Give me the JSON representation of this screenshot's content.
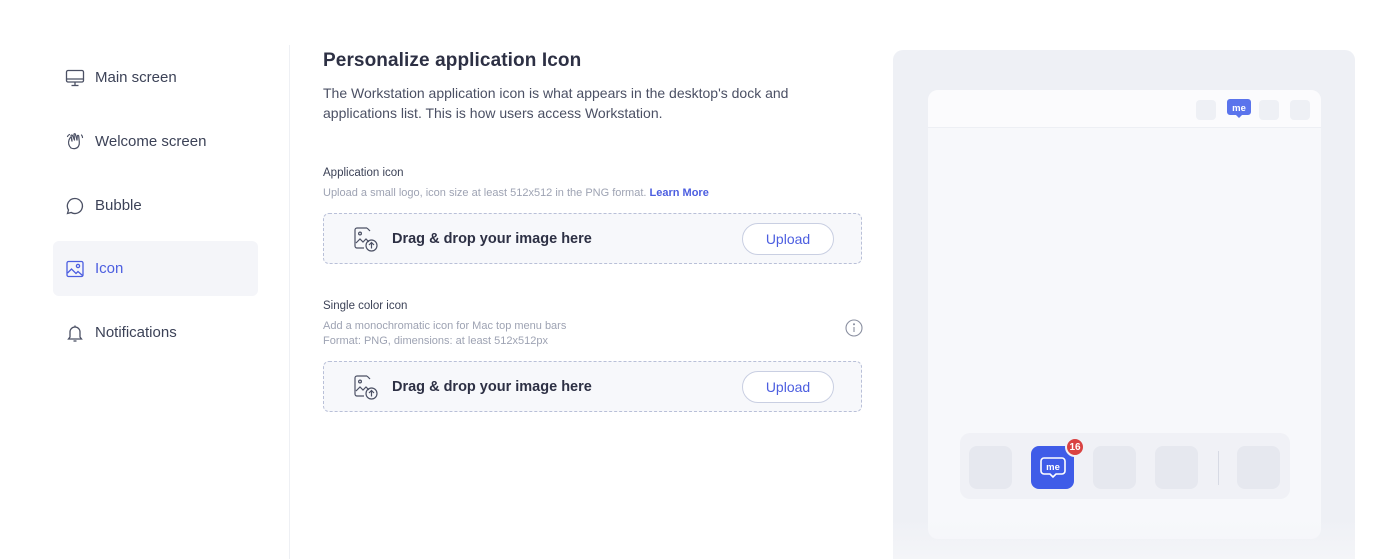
{
  "sidebar": {
    "items": [
      {
        "label": "Main screen",
        "icon": "monitor-icon",
        "active": false
      },
      {
        "label": "Welcome screen",
        "icon": "waving-hand-icon",
        "active": false
      },
      {
        "label": "Bubble",
        "icon": "chat-bubble-icon",
        "active": false
      },
      {
        "label": "Icon",
        "icon": "image-icon",
        "active": true
      },
      {
        "label": "Notifications",
        "icon": "bell-icon",
        "active": false
      }
    ]
  },
  "main": {
    "title": "Personalize application Icon",
    "description": "The Workstation application icon is what appears in the desktop's dock and applications list. This is how users access Workstation.",
    "app_icon": {
      "title": "Application icon",
      "subtitle": "Upload a small logo, icon size at least 512x512 in the PNG format.",
      "learn_more": "Learn More",
      "drop_text": "Drag & drop your image here",
      "upload_label": "Upload"
    },
    "single_color_icon": {
      "title": "Single color icon",
      "subtitle_line1": "Add a monochromatic icon for Mac top menu bars",
      "subtitle_line2": "Format: PNG, dimensions: at least 512x512px",
      "drop_text": "Drag & drop your image here",
      "upload_label": "Upload"
    }
  },
  "preview": {
    "menubar_logo": "me",
    "dock_logo": "me",
    "badge_count": "16"
  },
  "colors": {
    "accent": "#4c5ee0",
    "dock_app": "#3f5ce8",
    "badge": "#d94242"
  }
}
